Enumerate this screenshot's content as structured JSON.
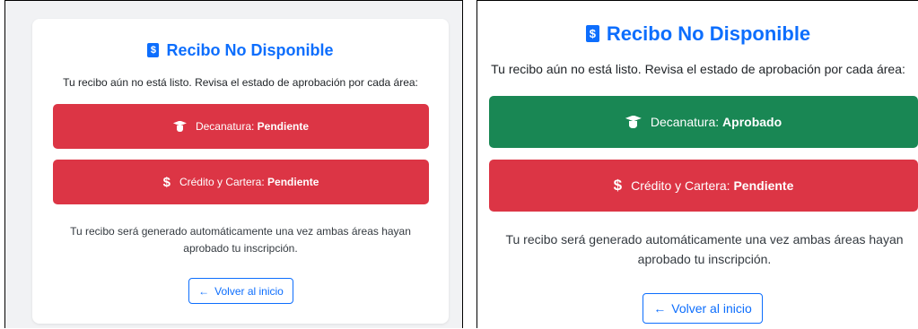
{
  "colors": {
    "primary": "#0d6efd",
    "pending": "#dc3545",
    "approved": "#198754"
  },
  "left": {
    "title": "Recibo No Disponible",
    "intro": "Tu recibo aún no está listo. Revisa el estado de aprobación por cada área:",
    "decanatura": {
      "label": "Decanatura:",
      "status": "Pendiente",
      "icon": "graduation-cap-icon"
    },
    "credito": {
      "label": "Crédito y Cartera:",
      "status": "Pendiente",
      "icon": "dollar-icon"
    },
    "outro": "Tu recibo será generado automáticamente una vez ambas áreas hayan aprobado tu inscripción.",
    "back_label": "Volver al inicio"
  },
  "right": {
    "title": "Recibo No Disponible",
    "intro": "Tu recibo aún no está listo. Revisa el estado de aprobación por cada área:",
    "decanatura": {
      "label": "Decanatura:",
      "status": "Aprobado",
      "icon": "graduation-cap-icon"
    },
    "credito": {
      "label": "Crédito y Cartera:",
      "status": "Pendiente",
      "icon": "dollar-icon"
    },
    "outro": "Tu recibo será generado automáticamente una vez ambas áreas hayan aprobado tu inscripción.",
    "back_label": "Volver al inicio"
  }
}
